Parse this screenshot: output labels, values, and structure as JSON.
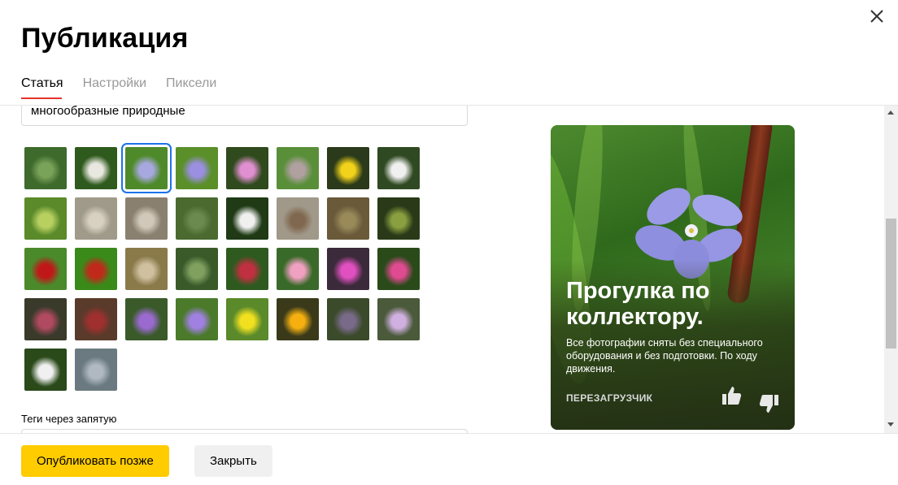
{
  "dialog": {
    "title": "Публикация",
    "tabs": [
      {
        "label": "Статья",
        "active": true
      },
      {
        "label": "Настройки",
        "active": false
      },
      {
        "label": "Пиксели",
        "active": false
      }
    ]
  },
  "form": {
    "text_value": "многообразные природные",
    "tags_label": "Теги через запятую",
    "tags_value": ""
  },
  "gallery": {
    "selected_index": 2,
    "thumbnails": [
      {
        "bg": "#3e6a2c",
        "accent": "#7aa35a"
      },
      {
        "bg": "#2f5a1d",
        "accent": "#e8e8e0"
      },
      {
        "bg": "#4f8a2a",
        "accent": "#a8a8e0"
      },
      {
        "bg": "#5a8f2a",
        "accent": "#9a8fe0"
      },
      {
        "bg": "#2f4a1c",
        "accent": "#e08fd0"
      },
      {
        "bg": "#5a8f3a",
        "accent": "#b0a0a0"
      },
      {
        "bg": "#2a3a1a",
        "accent": "#f2d21a"
      },
      {
        "bg": "#2f4a22",
        "accent": "#f0f0f0"
      },
      {
        "bg": "#5a8a2a",
        "accent": "#b8d060"
      },
      {
        "bg": "#a09a8a",
        "accent": "#d8d0c0"
      },
      {
        "bg": "#8a8070",
        "accent": "#d0c8b8"
      },
      {
        "bg": "#4a6a30",
        "accent": "#6a8a50"
      },
      {
        "bg": "#1f3a15",
        "accent": "#f0f0f0"
      },
      {
        "bg": "#a09888",
        "accent": "#806850"
      },
      {
        "bg": "#6a5a3a",
        "accent": "#9a8a5a"
      },
      {
        "bg": "#2a3a18",
        "accent": "#8aa040"
      },
      {
        "bg": "#4a8a2a",
        "accent": "#c01818"
      },
      {
        "bg": "#3a8a1a",
        "accent": "#c02a1a"
      },
      {
        "bg": "#8a7a4a",
        "accent": "#d0c0a0"
      },
      {
        "bg": "#3a5a2a",
        "accent": "#80a060"
      },
      {
        "bg": "#2f5a1f",
        "accent": "#c03040"
      },
      {
        "bg": "#3a6a2a",
        "accent": "#f0a0c0"
      },
      {
        "bg": "#3a2a3a",
        "accent": "#e050c0"
      },
      {
        "bg": "#2a4a1a",
        "accent": "#e04a90"
      },
      {
        "bg": "#3a3a2a",
        "accent": "#b04a60"
      },
      {
        "bg": "#5a3a2a",
        "accent": "#a03030"
      },
      {
        "bg": "#3a5a2a",
        "accent": "#9a6ad0"
      },
      {
        "bg": "#4a7a2a",
        "accent": "#a080e0"
      },
      {
        "bg": "#5a8a2a",
        "accent": "#f0e020"
      },
      {
        "bg": "#3a3a1a",
        "accent": "#f5b010"
      },
      {
        "bg": "#3a4a2a",
        "accent": "#7a6a8a"
      },
      {
        "bg": "#4a5a3a",
        "accent": "#d0b0e0"
      },
      {
        "bg": "#2a4a1a",
        "accent": "#f0f0f0"
      },
      {
        "bg": "#6a7a80",
        "accent": "#b0b8c0"
      }
    ]
  },
  "preview": {
    "title": "Прогулка по коллектору.",
    "description": "Все фотографии сняты без специального оборудования и без подготовки. По ходу движения.",
    "source": "ПЕРЕЗАГРУЗЧИК"
  },
  "footer": {
    "publish_later_label": "Опубликовать позже",
    "close_label": "Закрыть"
  },
  "colors": {
    "accent_yellow": "#ffcc00",
    "active_tab_underline": "#e6332a",
    "selection_outline": "#1a73e8"
  },
  "icons": [
    "close-icon",
    "thumbs-up-icon",
    "thumbs-down-icon",
    "scroll-up-arrow-icon",
    "scroll-down-arrow-icon"
  ]
}
